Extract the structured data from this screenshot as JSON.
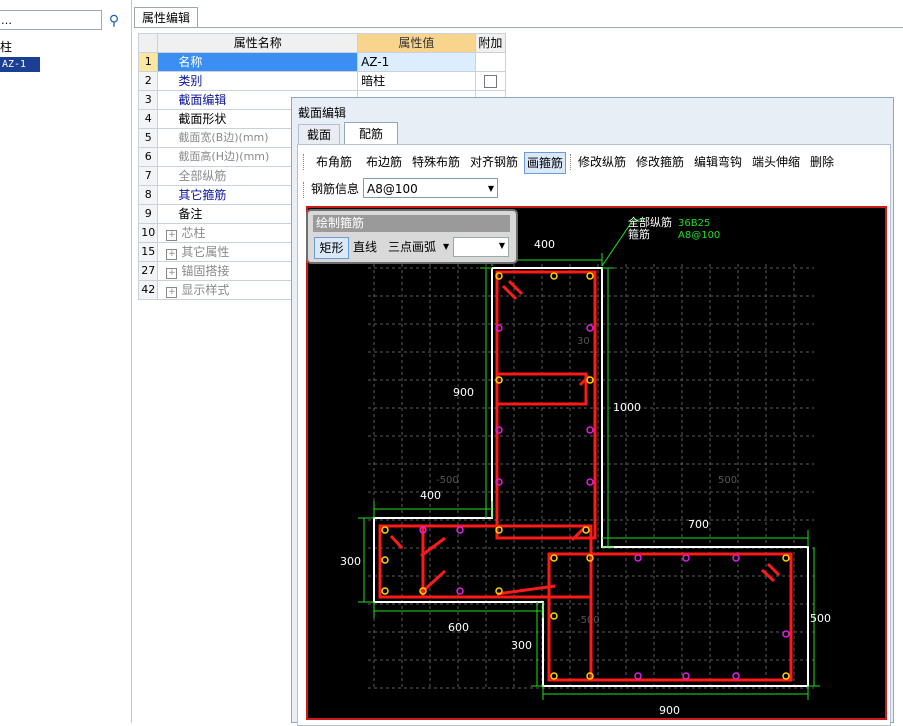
{
  "left_panel": {
    "search_placeholder": "…",
    "tree_item_1": "柱",
    "tree_item_2": "AZ-1"
  },
  "property_tab": "属性编辑",
  "grid": {
    "headers": {
      "name": "属性名称",
      "value": "属性值",
      "extra": "附加"
    },
    "rows": [
      {
        "num": "1",
        "name": "名称",
        "value": "AZ-1"
      },
      {
        "num": "2",
        "name": "类别",
        "value": "暗柱"
      },
      {
        "num": "3",
        "name": "截面编辑",
        "value": ""
      },
      {
        "num": "4",
        "name": "截面形状",
        "value": ""
      },
      {
        "num": "5",
        "name": "截面宽(B边)(mm)",
        "value": ""
      },
      {
        "num": "6",
        "name": "截面高(H边)(mm)",
        "value": ""
      },
      {
        "num": "7",
        "name": "全部纵筋",
        "value": ""
      },
      {
        "num": "8",
        "name": "其它箍筋",
        "value": ""
      },
      {
        "num": "9",
        "name": "备注",
        "value": ""
      },
      {
        "num": "10",
        "name": "芯柱",
        "value": ""
      },
      {
        "num": "15",
        "name": "其它属性",
        "value": ""
      },
      {
        "num": "27",
        "name": "锚固搭接",
        "value": ""
      },
      {
        "num": "42",
        "name": "显示样式",
        "value": ""
      }
    ]
  },
  "dialog": {
    "title": "截面编辑",
    "tabs": [
      "截面",
      "配筋"
    ],
    "toolbar": [
      "布角筋",
      "布边筋",
      "特殊布筋",
      "对齐钢筋",
      "画箍筋",
      "修改纵筋",
      "修改箍筋",
      "编辑弯钩",
      "端头伸缩",
      "删除"
    ],
    "rebar_info_label": "钢筋信息",
    "rebar_info_value": "A8@100"
  },
  "popup": {
    "title": "绘制箍筋",
    "buttons": [
      "矩形",
      "直线",
      "三点画弧"
    ]
  },
  "drawing": {
    "label_all_rebar": "全部纵筋",
    "label_stirrup": "箍筋",
    "value_all_rebar": "36B25",
    "value_stirrup": "A8@100",
    "dims": [
      "400",
      "900",
      "1000",
      "400",
      "700",
      "300",
      "600",
      "300",
      "500",
      "900"
    ],
    "faint": [
      "-500",
      "500",
      "30",
      "-500"
    ]
  },
  "colors": {
    "rebar": "#ff1a1a",
    "dimension": "#22dd22",
    "outline": "#ffffff",
    "grid": "#5a5a5a",
    "rebar_yellow": "#ffd400",
    "rebar_magenta": "#e020e0"
  }
}
